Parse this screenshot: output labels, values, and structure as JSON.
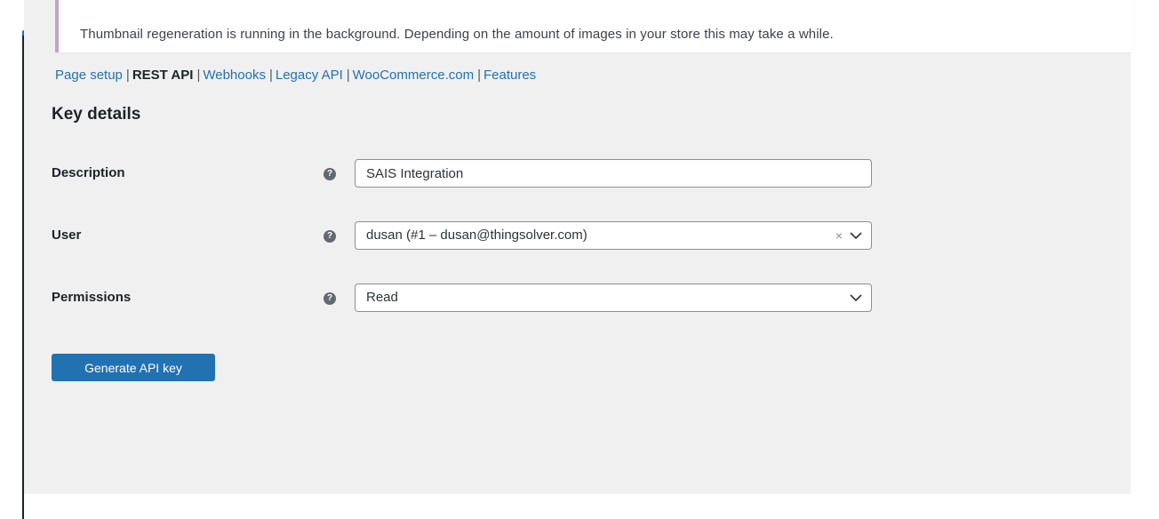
{
  "notice": {
    "text": "Thumbnail regeneration is running in the background. Depending on the amount of images in your store this may take a while."
  },
  "subnav": {
    "items": [
      {
        "label": "Page setup",
        "current": false
      },
      {
        "label": "REST API",
        "current": true
      },
      {
        "label": "Webhooks",
        "current": false
      },
      {
        "label": "Legacy API",
        "current": false
      },
      {
        "label": "WooCommerce.com",
        "current": false
      },
      {
        "label": "Features",
        "current": false
      }
    ],
    "separator": "|"
  },
  "page": {
    "title": "Key details"
  },
  "form": {
    "description": {
      "label": "Description",
      "value": "SAIS Integration",
      "help_icon": "question-circle-icon"
    },
    "user": {
      "label": "User",
      "value": "dusan (#1 – dusan@thingsolver.com)",
      "clear": "×",
      "help_icon": "question-circle-icon"
    },
    "permissions": {
      "label": "Permissions",
      "value": "Read",
      "help_icon": "question-circle-icon"
    },
    "help_glyph": "?"
  },
  "actions": {
    "generate_label": "Generate API key"
  },
  "colors": {
    "accent": "#2271b1",
    "background": "#f0f0f1",
    "notice_border": "#c9a0c9",
    "text": "#1d2327"
  }
}
